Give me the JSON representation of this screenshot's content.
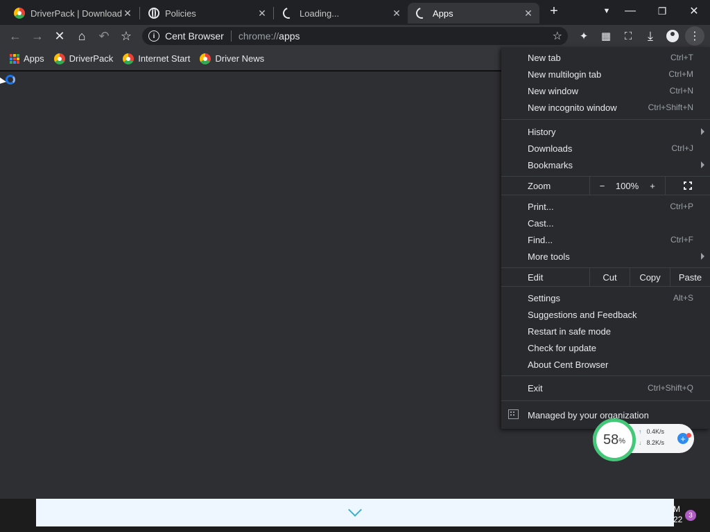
{
  "tabs": [
    {
      "title": "DriverPack | Download fr",
      "favicon": "driverpack-icon"
    },
    {
      "title": "Policies",
      "favicon": "globe-icon"
    },
    {
      "title": "Loading...",
      "favicon": "loading-spinner-icon"
    },
    {
      "title": "Apps",
      "favicon": "loading-spinner-icon",
      "active": true
    }
  ],
  "toolbar": {
    "site_label": "Cent Browser",
    "url_prefix": "chrome://",
    "url_path": "apps"
  },
  "bookmarks": [
    {
      "label": "Apps",
      "icon": "apps-grid-icon"
    },
    {
      "label": "DriverPack",
      "icon": "driverpack-icon"
    },
    {
      "label": "Internet Start",
      "icon": "driverpack-icon"
    },
    {
      "label": "Driver News",
      "icon": "driverpack-icon"
    }
  ],
  "menu": {
    "new_tab": {
      "label": "New tab",
      "shortcut": "Ctrl+T"
    },
    "new_multilogin_tab": {
      "label": "New multilogin tab",
      "shortcut": "Ctrl+M"
    },
    "new_window": {
      "label": "New window",
      "shortcut": "Ctrl+N"
    },
    "new_incognito": {
      "label": "New incognito window",
      "shortcut": "Ctrl+Shift+N"
    },
    "history": {
      "label": "History"
    },
    "downloads": {
      "label": "Downloads",
      "shortcut": "Ctrl+J"
    },
    "bookmarks": {
      "label": "Bookmarks"
    },
    "zoom": {
      "label": "Zoom",
      "minus": "−",
      "value": "100%",
      "plus": "+"
    },
    "print": {
      "label": "Print...",
      "shortcut": "Ctrl+P"
    },
    "cast": {
      "label": "Cast..."
    },
    "find": {
      "label": "Find...",
      "shortcut": "Ctrl+F"
    },
    "more_tools": {
      "label": "More tools"
    },
    "edit": {
      "label": "Edit",
      "cut": "Cut",
      "copy": "Copy",
      "paste": "Paste"
    },
    "settings": {
      "label": "Settings",
      "shortcut": "Alt+S"
    },
    "suggestions": {
      "label": "Suggestions and Feedback"
    },
    "safe_mode": {
      "label": "Restart in safe mode"
    },
    "check_update": {
      "label": "Check for update"
    },
    "about": {
      "label": "About Cent Browser"
    },
    "exit": {
      "label": "Exit",
      "shortcut": "Ctrl+Shift+Q"
    },
    "managed": {
      "label": "Managed by your organization"
    }
  },
  "net_widget": {
    "percent": "58",
    "percent_sign": "%",
    "upload": "0.4K/s",
    "download": "8.2K/s"
  },
  "taskbar": {
    "clock_line1": "M",
    "clock_line2": "22",
    "notification_count": "3"
  },
  "colors": {
    "accent": "#1a73e8",
    "gauge": "#45c77a",
    "badge": "#b05cc4"
  }
}
